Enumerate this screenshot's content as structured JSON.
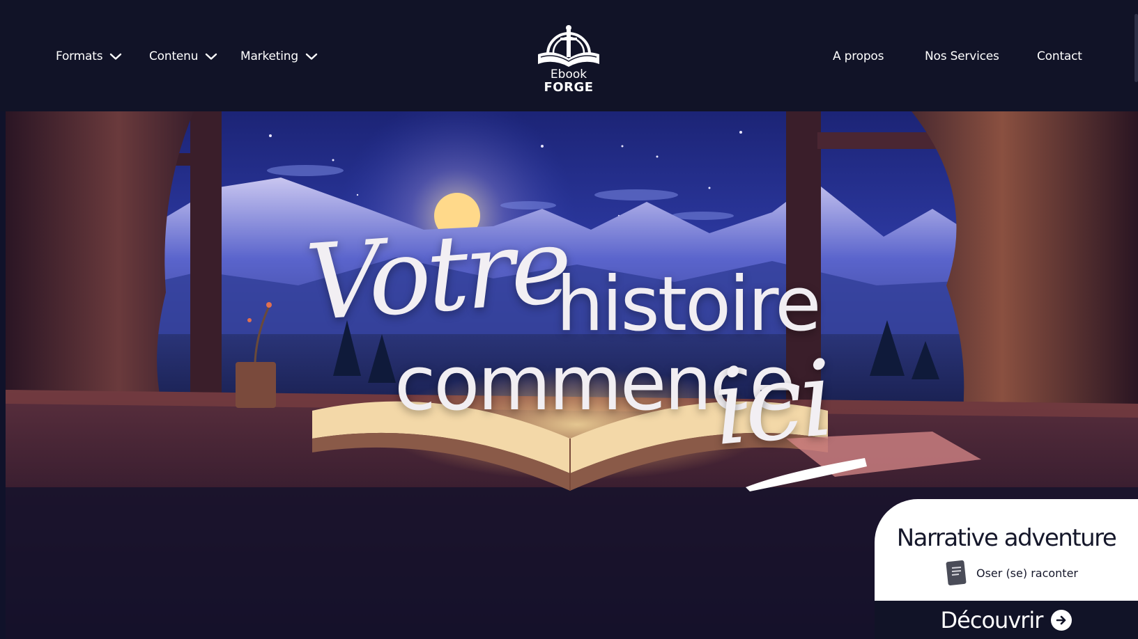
{
  "header": {
    "nav_left": [
      {
        "label": "Formats",
        "icon": "chevron-down-icon"
      },
      {
        "label": "Contenu",
        "icon": "chevron-down-icon"
      },
      {
        "label": "Marketing",
        "icon": "chevron-down-icon"
      }
    ],
    "logo": {
      "line1": "Ebook",
      "line2": "FORGE",
      "icon": "book-anvil-logo"
    },
    "nav_right": [
      {
        "label": "A propos"
      },
      {
        "label": "Nos Services"
      },
      {
        "label": "Contact"
      }
    ]
  },
  "hero": {
    "headline": {
      "word1": "Votre",
      "word2": "histoire",
      "word3": "commence",
      "word4": "ici"
    },
    "background": "night-mountain-window-open-book-illustration"
  },
  "card": {
    "title": "Narrative adventure",
    "subtitle": "Oser (se) raconter",
    "subtitle_icon": "book-icon",
    "cta_label": "Découvrir",
    "cta_icon": "arrow-right-circle-icon"
  },
  "colors": {
    "header_bg": "#111327",
    "card_bg": "#ffffff",
    "cta_bg": "#111327",
    "text_light": "#ffffff",
    "text_dark": "#15172a",
    "sky_blue": "#3b4fc4"
  }
}
